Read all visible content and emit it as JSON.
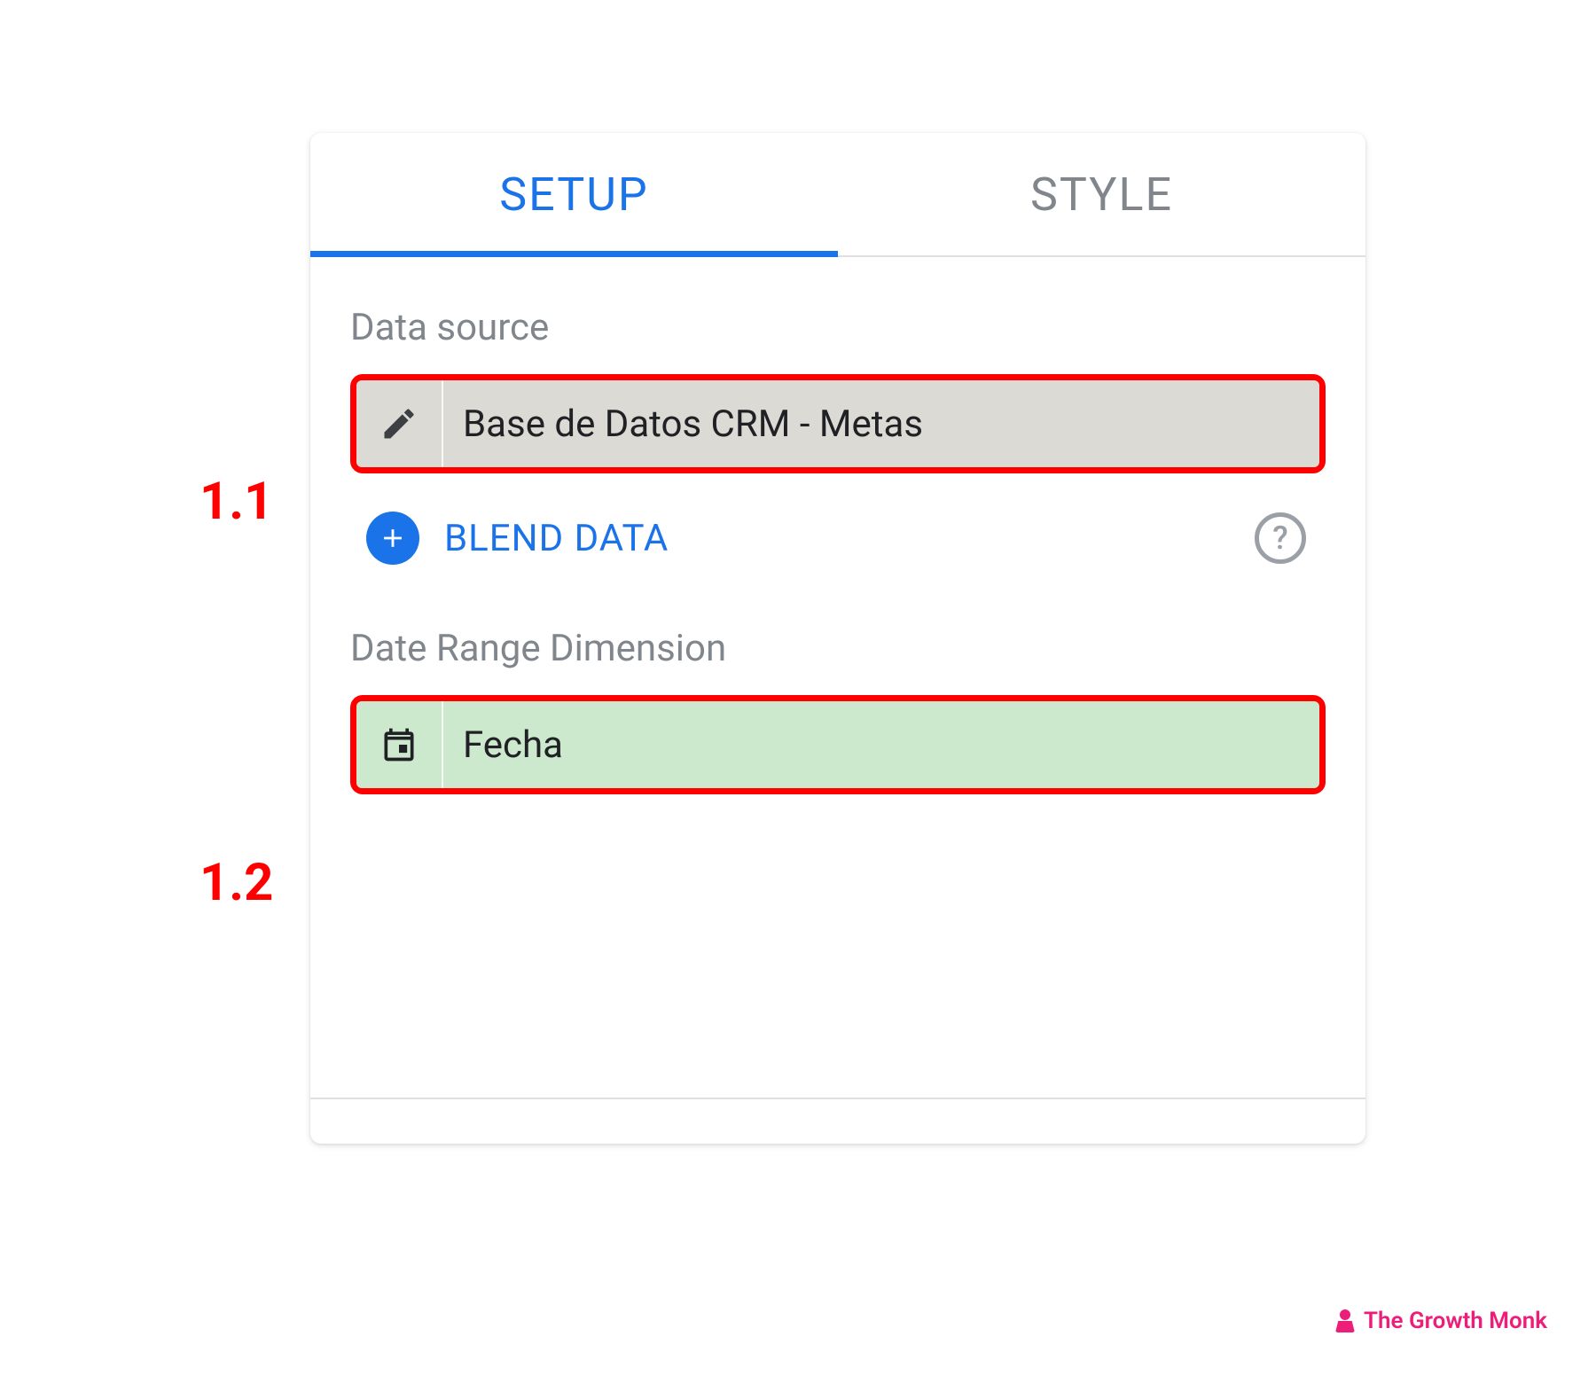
{
  "tabs": {
    "setup": "SETUP",
    "style": "STYLE"
  },
  "sections": {
    "data_source_label": "Data source",
    "date_range_label": "Date Range Dimension"
  },
  "data_source": {
    "name": "Base de Datos CRM - Metas"
  },
  "blend": {
    "label": "BLEND DATA"
  },
  "date_range": {
    "field": "Fecha"
  },
  "callouts": {
    "first": "1.1",
    "second": "1.2"
  },
  "watermark": {
    "text": "The Growth Monk"
  },
  "colors": {
    "accent": "#1a73e8",
    "muted": "#80868b",
    "highlight_border": "#ff0000",
    "chip_green": "#cce8cd",
    "chip_grey": "#dcdad4",
    "brand_pink": "#ec1e79"
  }
}
